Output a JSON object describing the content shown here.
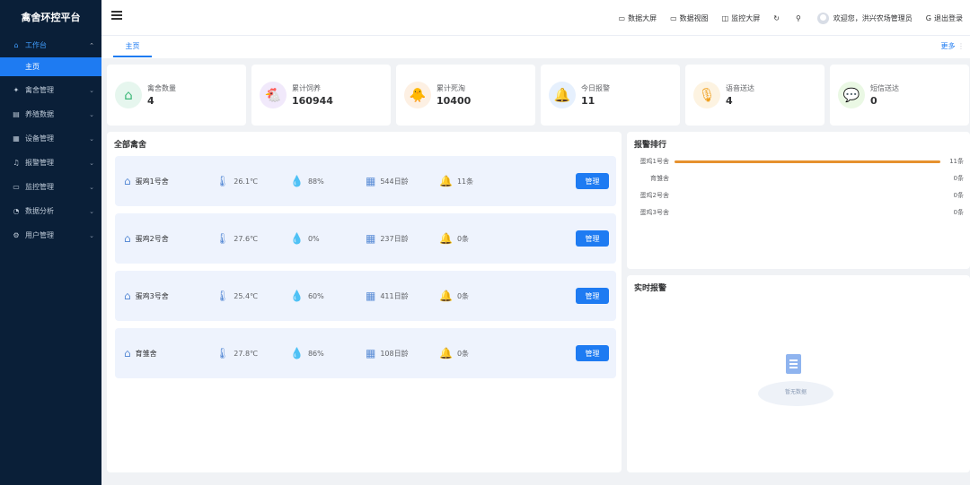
{
  "sidebar": {
    "brand": "禽舍环控平台",
    "menu": [
      {
        "label": "工作台",
        "icon": "⌂",
        "open": true
      },
      {
        "label": "禽舍管理",
        "icon": "✦"
      },
      {
        "label": "养殖数据",
        "icon": "▤"
      },
      {
        "label": "设备管理",
        "icon": "▦"
      },
      {
        "label": "报警管理",
        "icon": "♫"
      },
      {
        "label": "监控管理",
        "icon": "▭"
      },
      {
        "label": "数据分析",
        "icon": "◔"
      },
      {
        "label": "用户管理",
        "icon": "⚙"
      }
    ],
    "submenu_active": "主页"
  },
  "header": {
    "links": [
      "数据大屏",
      "数据视图",
      "监控大屏"
    ],
    "welcome": "欢迎您，洪兴农场管理员",
    "logout": "退出登录"
  },
  "tabs": {
    "active": "主页",
    "more": "更多"
  },
  "stats": [
    {
      "label": "禽舍数量",
      "value": "4",
      "icon": "house-icon",
      "color": "#3cb878",
      "bg": "#e6f6ee"
    },
    {
      "label": "累计饲养",
      "value": "160944",
      "icon": "chicken-icon",
      "color": "#9b59e0",
      "bg": "#f1e9fb"
    },
    {
      "label": "累计死淘",
      "value": "10400",
      "icon": "dead-chick-icon",
      "color": "#e6912e",
      "bg": "#fdf0e3"
    },
    {
      "label": "今日报警",
      "value": "11",
      "icon": "bell-icon",
      "color": "#2f86f5",
      "bg": "#e6f0fd"
    },
    {
      "label": "语音送达",
      "value": "4",
      "icon": "microphone-icon",
      "color": "#f0a020",
      "bg": "#fdf3e1"
    },
    {
      "label": "短信送达",
      "value": "0",
      "icon": "message-icon",
      "color": "#52c41a",
      "bg": "#eaf8e4"
    }
  ],
  "houses_panel": {
    "title": "全部禽舍",
    "manage_label": "管理",
    "houses": [
      {
        "name": "蛋鸡1号舍",
        "temp": "26.1℃",
        "humidity": "88%",
        "age": "544日龄",
        "alarms": "11条"
      },
      {
        "name": "蛋鸡2号舍",
        "temp": "27.6℃",
        "humidity": "0%",
        "age": "237日龄",
        "alarms": "0条"
      },
      {
        "name": "蛋鸡3号舍",
        "temp": "25.4℃",
        "humidity": "60%",
        "age": "411日龄",
        "alarms": "0条"
      },
      {
        "name": "育雏舍",
        "temp": "27.8℃",
        "humidity": "86%",
        "age": "108日龄",
        "alarms": "0条"
      }
    ]
  },
  "ranking_panel": {
    "title": "报警排行",
    "rows": [
      {
        "name": "蛋鸡1号舍",
        "count": "11条",
        "ratio": 1.0
      },
      {
        "name": "育雏舍",
        "count": "0条",
        "ratio": 0
      },
      {
        "name": "蛋鸡2号舍",
        "count": "0条",
        "ratio": 0
      },
      {
        "name": "蛋鸡3号舍",
        "count": "0条",
        "ratio": 0
      }
    ]
  },
  "realtime_panel": {
    "title": "实时报警",
    "empty_text": "暂无数据"
  }
}
